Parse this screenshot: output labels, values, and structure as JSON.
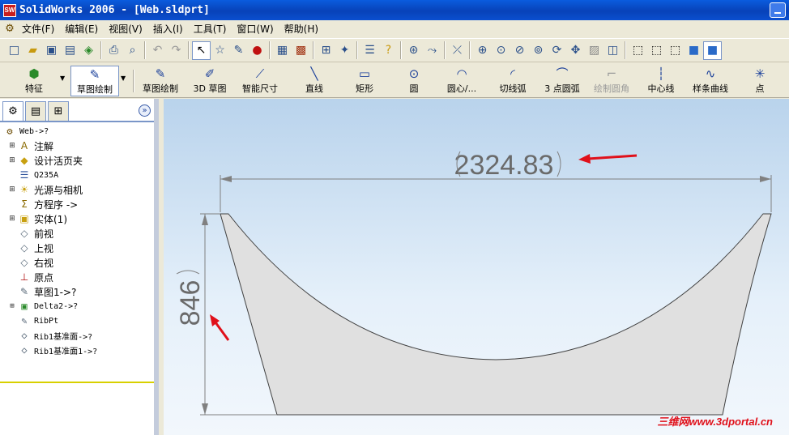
{
  "window": {
    "title": "SolidWorks 2006 - [Web.sldprt]",
    "app_icon_text": "SW"
  },
  "menubar": {
    "items": [
      "文件(F)",
      "编辑(E)",
      "视图(V)",
      "插入(I)",
      "工具(T)",
      "窗口(W)",
      "帮助(H)"
    ]
  },
  "toolbar1": {
    "icons": [
      "new-icon",
      "open-icon",
      "save-icon",
      "print-preview-icon",
      "rebuild-icon",
      "print-icon",
      "zoom-page-icon",
      "undo-icon",
      "redo-icon",
      "select-icon",
      "select-other-icon",
      "sketch-icon",
      "traffic-light-icon",
      "grid-icon",
      "brick-icon",
      "mate-icon",
      "move-component-icon",
      "properties-icon",
      "help-icon",
      "smart-fastener-icon",
      "measure-icon",
      "measure2-icon",
      "zoom-fit-icon",
      "zoom-area-icon",
      "zoom-in-out-icon",
      "zoom-selection-icon",
      "rotate-icon",
      "pan-icon",
      "view-3d-icon",
      "view-orientation-icon",
      "wireframe-icon",
      "hidden-lines-icon",
      "hidden-removed-icon",
      "shaded-edges-icon",
      "shaded-icon"
    ]
  },
  "toolbar2": {
    "feature_label": "特征",
    "sketch_drawing_label": "草图绘制",
    "buttons": [
      {
        "label": "草图绘制",
        "icon": "sketch-icon"
      },
      {
        "label": "3D 草图",
        "icon": "sketch-3d-icon"
      },
      {
        "label": "智能尺寸",
        "icon": "smart-dimension-icon"
      },
      {
        "label": "直线",
        "icon": "line-icon"
      },
      {
        "label": "矩形",
        "icon": "rectangle-icon"
      },
      {
        "label": "圆",
        "icon": "circle-icon"
      },
      {
        "label": "圆心/...",
        "icon": "centerpoint-arc-icon"
      },
      {
        "label": "切线弧",
        "icon": "tangent-arc-icon"
      },
      {
        "label": "3 点圆弧",
        "icon": "three-point-arc-icon"
      },
      {
        "label": "绘制圆角",
        "icon": "sketch-fillet-icon"
      },
      {
        "label": "中心线",
        "icon": "centerline-icon"
      },
      {
        "label": "样条曲线",
        "icon": "spline-icon"
      },
      {
        "label": "点",
        "icon": "point-icon"
      }
    ]
  },
  "feature_tree": {
    "root": "Web->?",
    "items": [
      {
        "label": "注解",
        "expandable": true,
        "icon": "annotations-icon"
      },
      {
        "label": "设计活页夹",
        "expandable": true,
        "icon": "design-binder-icon"
      },
      {
        "label": "Q235A",
        "expandable": false,
        "icon": "material-icon"
      },
      {
        "label": "光源与相机",
        "expandable": true,
        "icon": "lights-camera-icon"
      },
      {
        "label": "方程序 ->",
        "expandable": false,
        "icon": "equations-icon"
      },
      {
        "label": "实体(1)",
        "expandable": true,
        "icon": "solid-bodies-icon"
      },
      {
        "label": "前视",
        "expandable": false,
        "icon": "plane-icon"
      },
      {
        "label": "上视",
        "expandable": false,
        "icon": "plane-icon"
      },
      {
        "label": "右视",
        "expandable": false,
        "icon": "plane-icon"
      },
      {
        "label": "原点",
        "expandable": false,
        "icon": "origin-icon"
      },
      {
        "label": "草图1->?",
        "expandable": false,
        "icon": "sketch-icon"
      },
      {
        "label": "Delta2->?",
        "expandable": true,
        "icon": "feature-icon"
      },
      {
        "label": "RibPt",
        "expandable": false,
        "icon": "sketch-icon"
      },
      {
        "label": "Rib1基准面->?",
        "expandable": false,
        "icon": "plane-icon"
      },
      {
        "label": "Rib1基准面1->?",
        "expandable": false,
        "icon": "plane-icon"
      }
    ]
  },
  "graphics": {
    "dimension_horizontal": "2324.83",
    "dimension_vertical": "846",
    "watermark": "三维网www.3dportal.cn",
    "annotation_color": "#e0101a",
    "shape_fill": "#e0e0e0"
  }
}
